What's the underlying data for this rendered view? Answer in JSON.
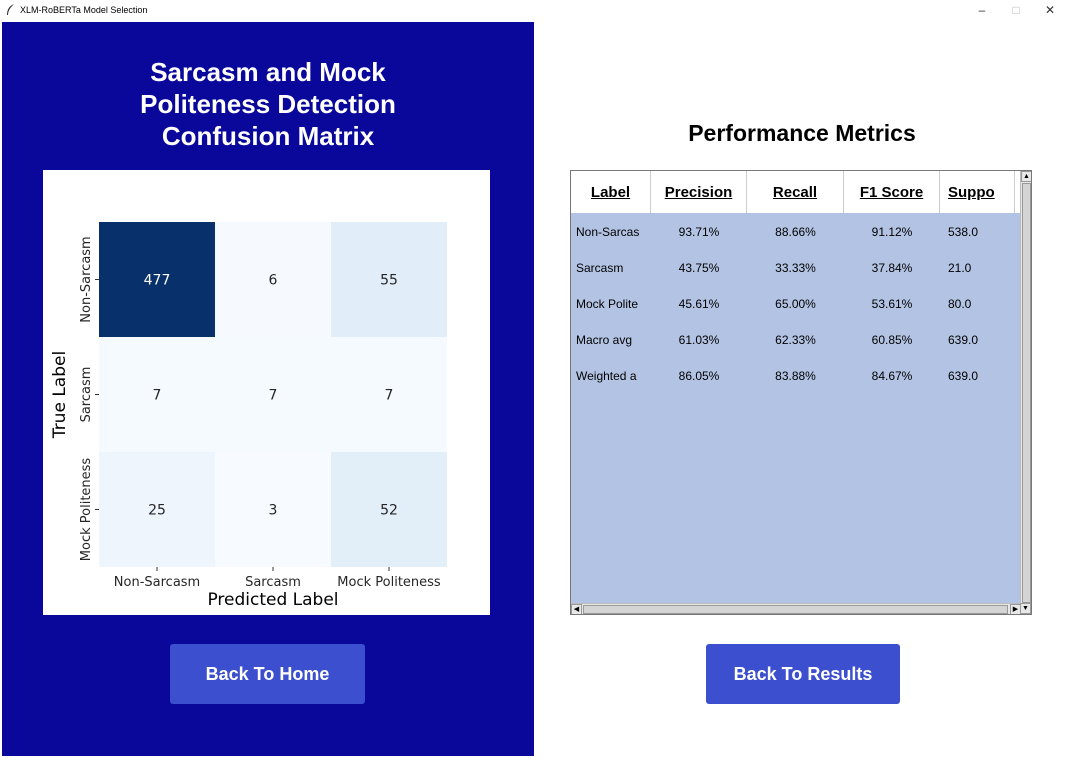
{
  "window": {
    "title": "XLM-RoBERTa Model Selection",
    "minimize": "–",
    "maximize": "□",
    "close": "✕"
  },
  "left": {
    "title_lines": [
      "Sarcasm and Mock",
      "Politeness Detection",
      "Confusion Matrix"
    ],
    "back_home_label": "Back To Home"
  },
  "chart_data": {
    "type": "heatmap",
    "title": "",
    "xlabel": "Predicted Label",
    "ylabel": "True Label",
    "x_categories": [
      "Non-Sarcasm",
      "Sarcasm",
      "Mock Politeness"
    ],
    "y_categories": [
      "Non-Sarcasm",
      "Sarcasm",
      "Mock Politeness"
    ],
    "values": [
      [
        477,
        6,
        55
      ],
      [
        7,
        7,
        7
      ],
      [
        25,
        3,
        52
      ]
    ],
    "colormap": "Blues",
    "colorbar": false
  },
  "right": {
    "title": "Performance Metrics",
    "columns": [
      "Label",
      "Precision",
      "Recall",
      "F1 Score",
      "Suppo"
    ],
    "rows": [
      [
        "Non-Sarcas",
        "93.71%",
        "88.66%",
        "91.12%",
        "538.0"
      ],
      [
        "Sarcasm",
        "43.75%",
        "33.33%",
        "37.84%",
        "21.0"
      ],
      [
        "Mock Polite",
        "45.61%",
        "65.00%",
        "53.61%",
        "80.0"
      ],
      [
        "Macro avg",
        "61.03%",
        "62.33%",
        "60.85%",
        "639.0"
      ],
      [
        "Weighted a",
        "86.05%",
        "83.88%",
        "84.67%",
        "639.0"
      ]
    ],
    "back_results_label": "Back To Results"
  },
  "colors": {
    "left_panel_bg": "#09089a",
    "button_bg": "#3b4fcf",
    "table_bg": "#b3c3e3"
  }
}
